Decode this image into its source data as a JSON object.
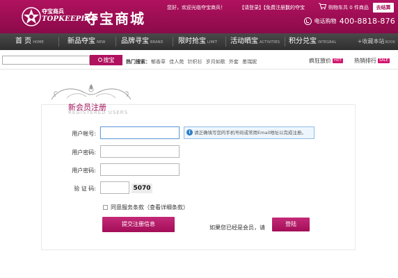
{
  "header": {
    "logo_cn_small": "夺宝商兵",
    "logo_en": "TOPKEEPING",
    "logo_cn_big": "夺宝商城",
    "welcome": "您好，欢迎光临夺宝商兵！",
    "login": "【请登录】",
    "register": "【免费注册】",
    "my_treasure": "我的夺宝",
    "cart_text": "购物车共 0 件商品",
    "checkout": "去结算",
    "phone_label": "电话购物",
    "phone_number": "400-8818-876",
    "brand_color": "#a30e57"
  },
  "nav": {
    "items": [
      {
        "cn": "首 页",
        "en": "HOME"
      },
      {
        "cn": "新品夺宝",
        "en": "NEW"
      },
      {
        "cn": "品牌寻宝",
        "en": "BRAND"
      },
      {
        "cn": "限时抢宝",
        "en": "LIMIT"
      },
      {
        "cn": "活动晒宝",
        "en": "ACTIVITIES"
      },
      {
        "cn": "积分兑宝",
        "en": "INTEGRAL"
      }
    ],
    "favorite": "+收藏本站",
    "favorite_en": "BOOK"
  },
  "search": {
    "placeholder": "",
    "button": "搜宝",
    "hot_label": "热门搜索：",
    "hot_words": [
      "郁香草",
      "佳人苑",
      "针织衫",
      "岁月如歌",
      "外套",
      "墨瑞妮"
    ],
    "promo_1": "疯狂放价",
    "promo_1_tag": "HOT",
    "promo_2": "热销排行",
    "promo_2_tag": "SALE"
  },
  "register": {
    "title": "新会员注册",
    "subtitle": "REGISTERED USERS",
    "account_label": "用户帐号:",
    "password_label": "用户密码:",
    "confirm_label": "用户密码:",
    "captcha_label": "验 证 码:",
    "hint": "请正确填写您的手机号码或常用Email地址以完成注册。",
    "captcha_code": "5070",
    "agree_text": "同意服务条款（查看详细条款）",
    "submit": "提交注册信息",
    "already_member": "如果您已经是会员，请",
    "login_button": "登陆"
  }
}
